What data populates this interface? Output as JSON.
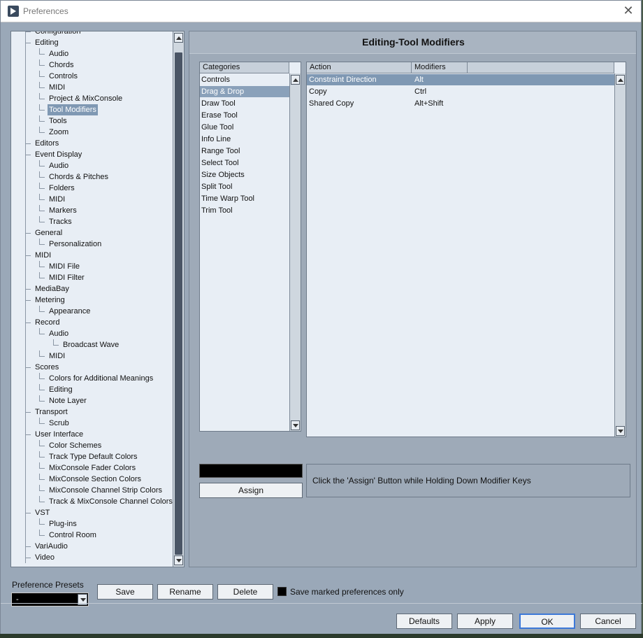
{
  "window": {
    "title": "Preferences"
  },
  "tree": {
    "items": [
      {
        "label": "Configuration",
        "level": 1
      },
      {
        "label": "Editing",
        "level": 1
      },
      {
        "label": "Audio",
        "level": 2
      },
      {
        "label": "Chords",
        "level": 2
      },
      {
        "label": "Controls",
        "level": 2
      },
      {
        "label": "MIDI",
        "level": 2
      },
      {
        "label": "Project & MixConsole",
        "level": 2
      },
      {
        "label": "Tool Modifiers",
        "level": 2,
        "selected": true
      },
      {
        "label": "Tools",
        "level": 2
      },
      {
        "label": "Zoom",
        "level": 2
      },
      {
        "label": "Editors",
        "level": 1
      },
      {
        "label": "Event Display",
        "level": 1
      },
      {
        "label": "Audio",
        "level": 2
      },
      {
        "label": "Chords & Pitches",
        "level": 2
      },
      {
        "label": "Folders",
        "level": 2
      },
      {
        "label": "MIDI",
        "level": 2
      },
      {
        "label": "Markers",
        "level": 2
      },
      {
        "label": "Tracks",
        "level": 2
      },
      {
        "label": "General",
        "level": 1
      },
      {
        "label": "Personalization",
        "level": 2
      },
      {
        "label": "MIDI",
        "level": 1
      },
      {
        "label": "MIDI File",
        "level": 2
      },
      {
        "label": "MIDI Filter",
        "level": 2
      },
      {
        "label": "MediaBay",
        "level": 1
      },
      {
        "label": "Metering",
        "level": 1
      },
      {
        "label": "Appearance",
        "level": 2
      },
      {
        "label": "Record",
        "level": 1
      },
      {
        "label": "Audio",
        "level": 2
      },
      {
        "label": "Broadcast Wave",
        "level": 3
      },
      {
        "label": "MIDI",
        "level": 2
      },
      {
        "label": "Scores",
        "level": 1
      },
      {
        "label": "Colors for Additional Meanings",
        "level": 2
      },
      {
        "label": "Editing",
        "level": 2
      },
      {
        "label": "Note Layer",
        "level": 2
      },
      {
        "label": "Transport",
        "level": 1
      },
      {
        "label": "Scrub",
        "level": 2
      },
      {
        "label": "User Interface",
        "level": 1
      },
      {
        "label": "Color Schemes",
        "level": 2
      },
      {
        "label": "Track Type Default Colors",
        "level": 2
      },
      {
        "label": "MixConsole Fader Colors",
        "level": 2
      },
      {
        "label": "MixConsole Section Colors",
        "level": 2
      },
      {
        "label": "MixConsole Channel Strip Colors",
        "level": 2
      },
      {
        "label": "Track & MixConsole Channel Colors",
        "level": 2
      },
      {
        "label": "VST",
        "level": 1
      },
      {
        "label": "Plug-ins",
        "level": 2
      },
      {
        "label": "Control Room",
        "level": 2
      },
      {
        "label": "VariAudio",
        "level": 1
      },
      {
        "label": "Video",
        "level": 1
      }
    ]
  },
  "panel": {
    "title": "Editing-Tool Modifiers",
    "categories_header": "Categories",
    "categories": [
      "Controls",
      "Drag & Drop",
      "Draw Tool",
      "Erase Tool",
      "Glue Tool",
      "Info Line",
      "Range Tool",
      "Select Tool",
      "Size Objects",
      "Split Tool",
      "Time Warp Tool",
      "Trim Tool"
    ],
    "selected_category": 1,
    "action_header": "Action",
    "modifiers_header": "Modifiers",
    "actions": [
      {
        "action": "Constraint Direction",
        "modifiers": "Alt"
      },
      {
        "action": "Copy",
        "modifiers": "Ctrl"
      },
      {
        "action": "Shared Copy",
        "modifiers": "Alt+Shift"
      }
    ],
    "selected_action": 0,
    "assign_label": "Assign",
    "hint": "Click the 'Assign' Button while Holding Down Modifier Keys"
  },
  "presets": {
    "label": "Preference Presets",
    "value": "-",
    "save_label": "Save",
    "rename_label": "Rename",
    "delete_label": "Delete",
    "save_marked_label": "Save marked preferences only"
  },
  "footer": {
    "defaults_label": "Defaults",
    "apply_label": "Apply",
    "ok_label": "OK",
    "cancel_label": "Cancel"
  },
  "colors": {
    "selection": "#7f98b3",
    "window_bg": "#9aa8b8",
    "list_bg": "#e8eef5"
  }
}
